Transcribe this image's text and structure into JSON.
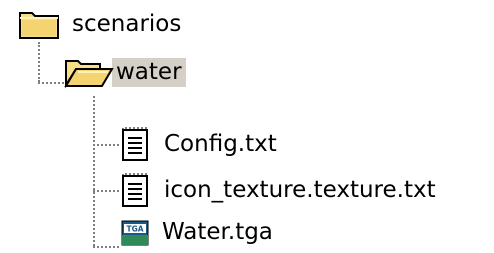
{
  "tree": {
    "root": {
      "label": "scenarios",
      "icon": "folder-closed-icon",
      "children": [
        {
          "label": "water",
          "icon": "folder-open-icon",
          "selected": true,
          "children": [
            {
              "label": "Config.txt",
              "icon": "text-file-icon"
            },
            {
              "label": "icon_texture.texture.txt",
              "icon": "text-file-icon"
            },
            {
              "label": "Water.tga",
              "icon": "tga-image-icon",
              "badge": "TGA"
            }
          ]
        }
      ]
    }
  },
  "colors": {
    "folder_yellow": "#f8e088",
    "folder_dark": "#000000",
    "selection": "#d4d0c8",
    "connector": "#808080",
    "tga_badge": "#1a5a8a"
  }
}
